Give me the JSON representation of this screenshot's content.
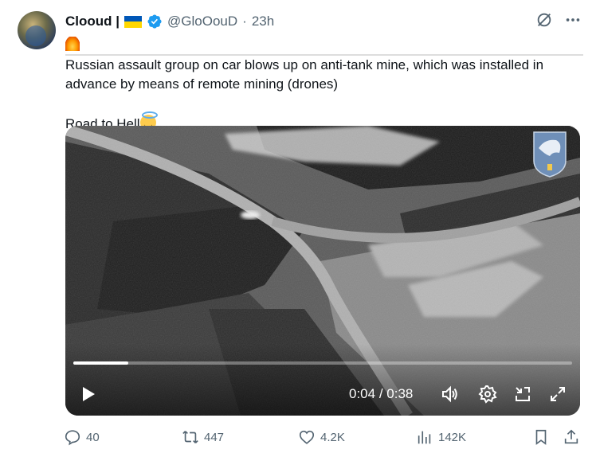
{
  "tweet": {
    "author_name": "Clooud |",
    "handle": "@GloOouD",
    "separator": "·",
    "time": "23h",
    "text_line1": "Russian assault group on car blows up on anti-tank mine, which was installed in advance by means of remote mining (drones)",
    "text_line2": "Road to Hell"
  },
  "video": {
    "current_time": "0:04",
    "duration": "0:38",
    "time_separator": " / ",
    "progress_fraction": 0.11
  },
  "actions": {
    "replies": "40",
    "reposts": "447",
    "likes": "4.2K",
    "views": "142K"
  },
  "icons": {
    "verified": "verified-badge-icon",
    "grok": "grok-icon",
    "more": "more-icon",
    "play": "play-icon",
    "volume": "volume-icon",
    "settings": "gear-icon",
    "minimize": "minimize-icon",
    "fullscreen": "fullscreen-icon",
    "reply": "reply-icon",
    "repost": "repost-icon",
    "like": "heart-icon",
    "views": "views-icon",
    "bookmark": "bookmark-icon",
    "share": "share-icon"
  },
  "colors": {
    "accent": "#1d9bf0",
    "text": "#0f1419",
    "secondary": "#536471"
  }
}
